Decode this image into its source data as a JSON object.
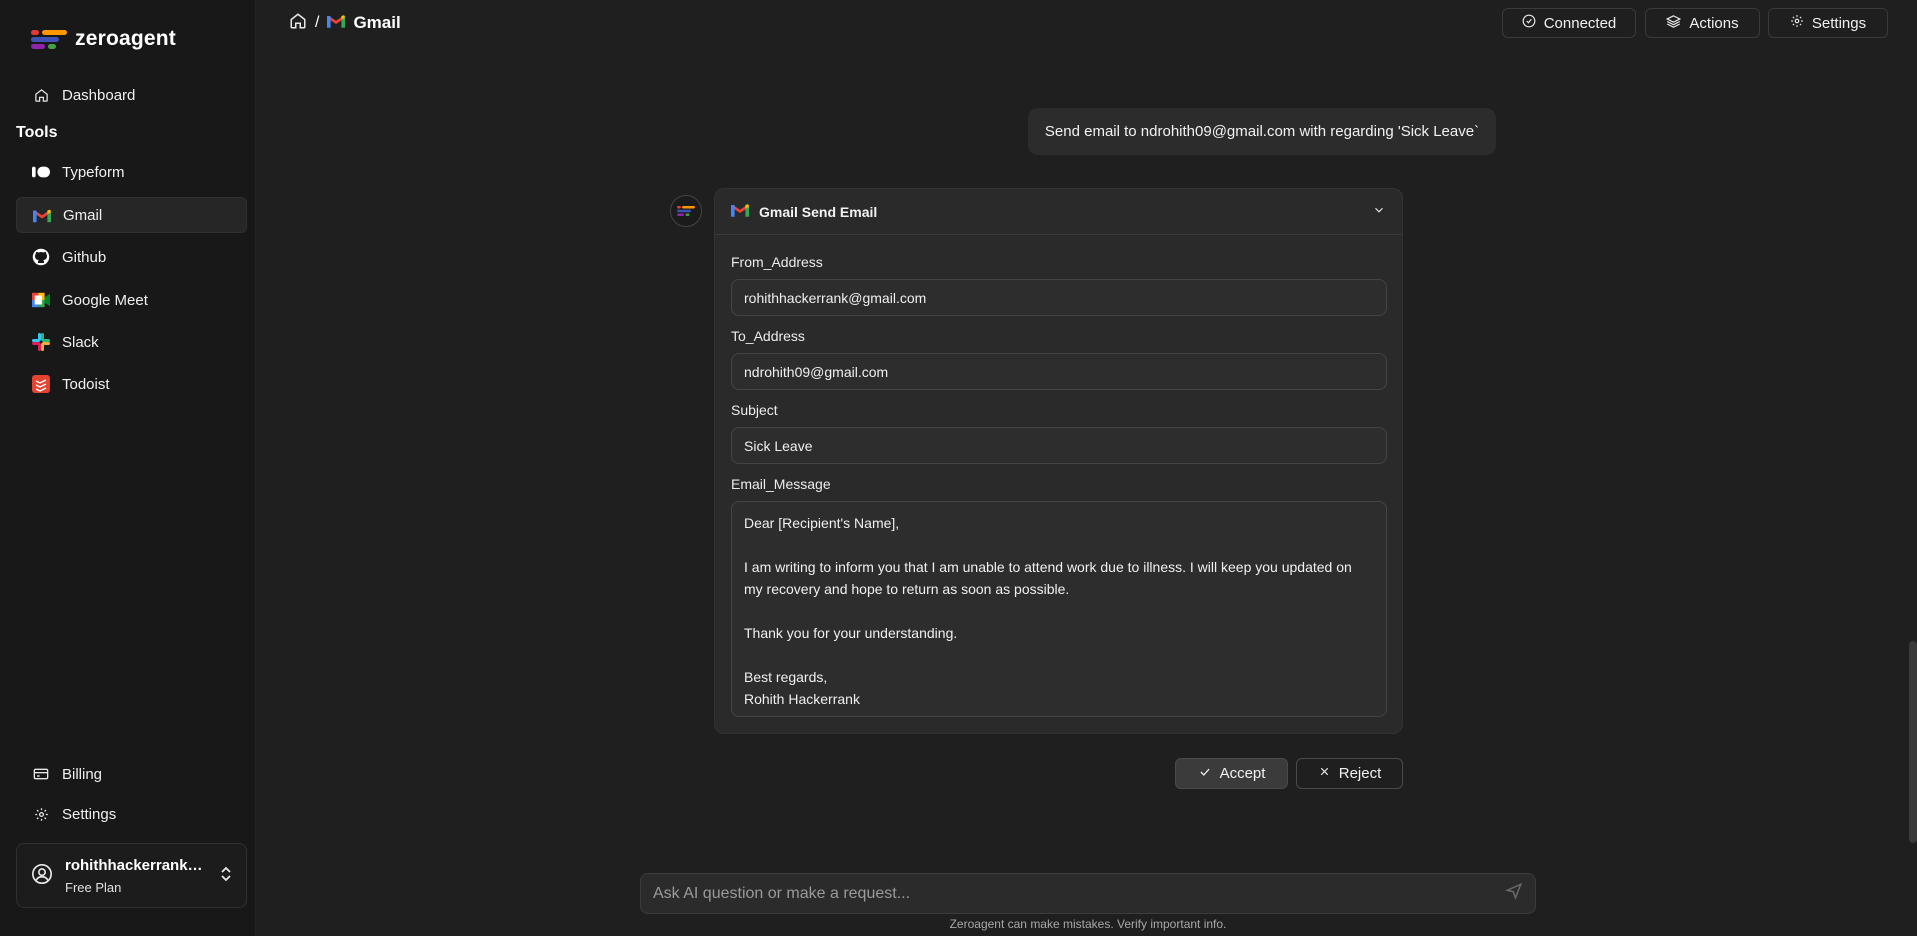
{
  "app": {
    "name": "zeroagent"
  },
  "sidebar": {
    "dashboard_label": "Dashboard",
    "tools_heading": "Tools",
    "tools": [
      {
        "label": "Typeform",
        "icon": "typeform-icon"
      },
      {
        "label": "Gmail",
        "icon": "gmail-icon",
        "active": true
      },
      {
        "label": "Github",
        "icon": "github-icon"
      },
      {
        "label": "Google Meet",
        "icon": "google-meet-icon"
      },
      {
        "label": "Slack",
        "icon": "slack-icon"
      },
      {
        "label": "Todoist",
        "icon": "todoist-icon"
      }
    ],
    "billing_label": "Billing",
    "settings_label": "Settings",
    "user": {
      "name": "rohithhackerrank@...",
      "plan": "Free Plan"
    }
  },
  "header": {
    "separator": "/",
    "title": "Gmail",
    "connected_label": "Connected",
    "actions_label": "Actions",
    "settings_label": "Settings"
  },
  "chat": {
    "user_message": "Send email to ndrohith09@gmail.com with regarding 'Sick Leave`",
    "tool_card": {
      "title": "Gmail Send Email",
      "from_label": "From_Address",
      "from_value": "rohithhackerrank@gmail.com",
      "to_label": "To_Address",
      "to_value": "ndrohith09@gmail.com",
      "subject_label": "Subject",
      "subject_value": "Sick Leave",
      "message_label": "Email_Message",
      "message_value": "Dear [Recipient's Name],\n\nI am writing to inform you that I am unable to attend work due to illness. I will keep you updated on my recovery and hope to return as soon as possible.\n\nThank you for your understanding.\n\nBest regards,\nRohith Hackerrank"
    },
    "accept_label": "Accept",
    "reject_label": "Reject"
  },
  "composer": {
    "placeholder": "Ask AI question or make a request...",
    "disclaimer": "Zeroagent can make mistakes. Verify important info."
  },
  "colors": {
    "background": "#1f1f1f",
    "sidebar": "#181818",
    "card": "#2a2a2a"
  }
}
